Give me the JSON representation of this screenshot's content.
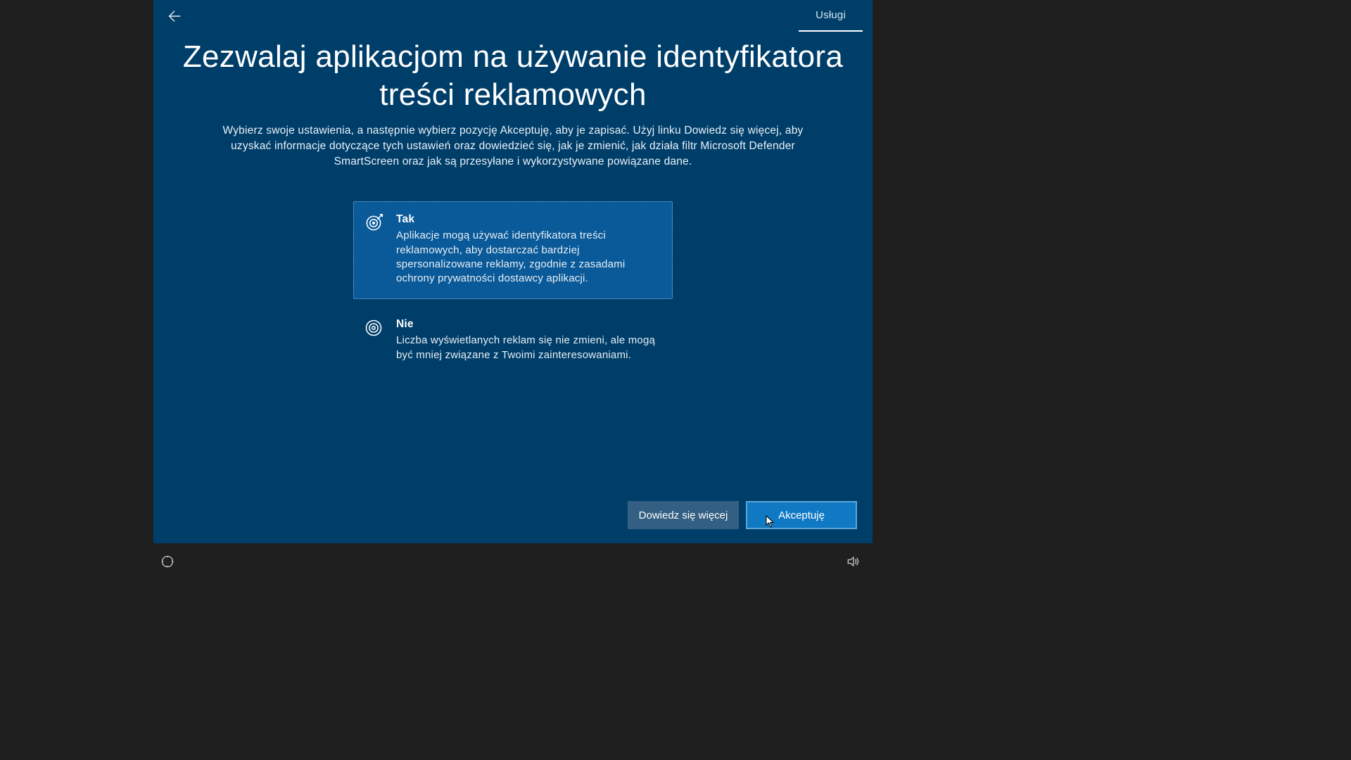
{
  "header": {
    "tab_label": "Usługi"
  },
  "page": {
    "title": "Zezwalaj aplikacjom na używanie identyfikatora treści reklamowych",
    "subtitle": "Wybierz swoje ustawienia, a następnie wybierz pozycję Akceptuję, aby je zapisać. Użyj linku Dowiedz się więcej, aby uzyskać informacje dotyczące tych ustawień oraz dowiedzieć się, jak je zmienić, jak działa filtr Microsoft Defender SmartScreen oraz jak są przesyłane i wykorzystywane powiązane dane."
  },
  "options": [
    {
      "title": "Tak",
      "desc": "Aplikacje mogą używać identyfikatora treści reklamowych, aby dostarczać bardziej spersonalizowane reklamy, zgodnie z zasadami ochrony prywatności dostawcy aplikacji.",
      "selected": true,
      "icon": "target-icon"
    },
    {
      "title": "Nie",
      "desc": "Liczba wyświetlanych reklam się nie zmieni, ale mogą być mniej związane z Twoimi zainteresowaniami.",
      "selected": false,
      "icon": "circles-icon"
    }
  ],
  "buttons": {
    "learn_more": "Dowiedz się więcej",
    "accept": "Akceptuję"
  },
  "colors": {
    "stage_bg": "#003e6a",
    "selected_bg": "#0a5a99",
    "primary_btn": "#1079c4"
  }
}
